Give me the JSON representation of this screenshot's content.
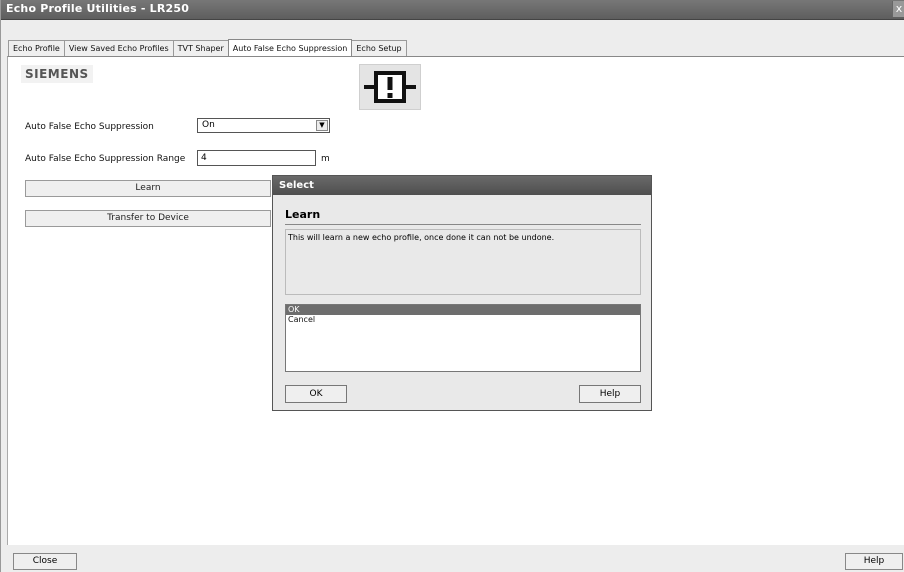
{
  "window": {
    "title": "Echo Profile Utilities - LR250",
    "close_glyph": "x"
  },
  "tabs": [
    {
      "label": "Echo Profile"
    },
    {
      "label": "View Saved Echo Profiles"
    },
    {
      "label": "TVT Shaper"
    },
    {
      "label": "Auto False Echo Suppression",
      "active": true
    },
    {
      "label": "Echo Setup"
    }
  ],
  "logo": {
    "text": "SIEMENS"
  },
  "form": {
    "afes_label": "Auto False Echo Suppression",
    "afes_value": "On",
    "range_label": "Auto False Echo Suppression Range",
    "range_value": "4",
    "range_unit": "m",
    "learn_label": "Learn",
    "transfer_label": "Transfer to Device"
  },
  "dialog": {
    "title": "Select",
    "heading": "Learn",
    "message": "This will learn a new echo profile, once done it can not be undone.",
    "options": [
      "OK",
      "Cancel"
    ],
    "selected_option": "OK",
    "ok_label": "OK",
    "help_label": "Help"
  },
  "footer": {
    "close_label": "Close",
    "help_label": "Help"
  },
  "colors": {
    "titlebar": "#5e5e5e",
    "selection": "#6d6d6d"
  }
}
